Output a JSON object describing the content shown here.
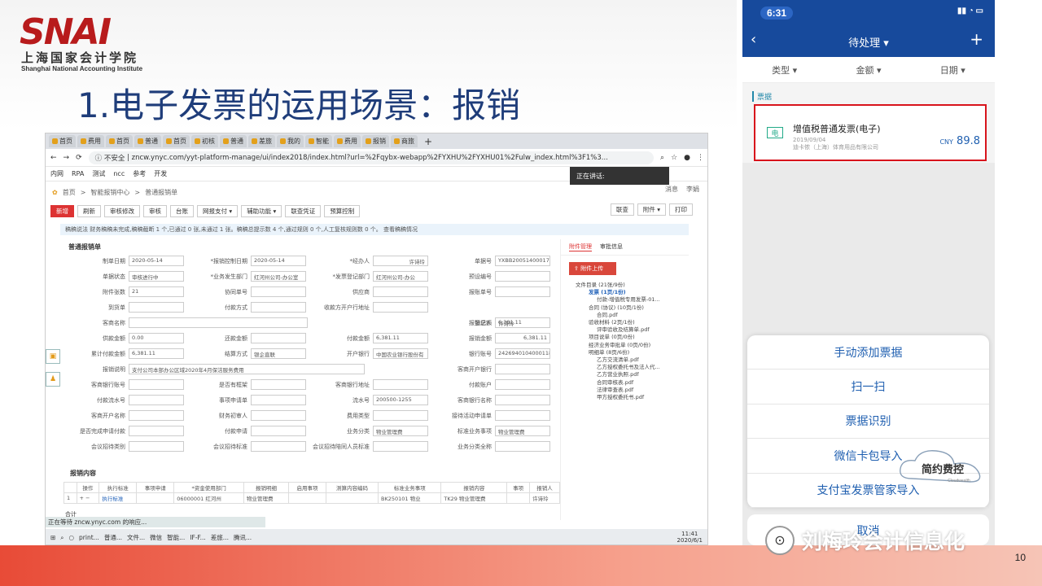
{
  "slide": {
    "logo_word": "SNAI",
    "logo_cn": "上海国家会计学院",
    "logo_en": "Shanghai National Accounting Institute",
    "title": "1.电子发票的运用场景：报销",
    "page_number": "10"
  },
  "browser": {
    "tabs": [
      "首页",
      "费用",
      "首页",
      "普通",
      "首页",
      "初核",
      "普通",
      "差旅",
      "我的",
      "智能",
      "费用",
      "报销",
      "商旅"
    ],
    "url_security": "不安全",
    "url": "zncw.ynyc.com/yyt-platform-manage/ui/index2018/index.html?url=%2Fqybx-webapp%2FYXHU%2FYXHU01%2Fulw_index.html%3F1%3...",
    "bookmarks": [
      "内网",
      "RPA",
      "测试",
      "ncc",
      "参考",
      "开发"
    ],
    "speaking": "正在讲话:",
    "status": "正在等待 zncw.ynyc.com 的响应..."
  },
  "app": {
    "breadcrumb": [
      "首页",
      "智能报销中心",
      "普通报销单"
    ],
    "nav_right": [
      "消息",
      "李娟"
    ],
    "toolbar": [
      "新增",
      "刷新",
      "审核修改",
      "审核",
      "台账",
      "网报支付 ▾",
      "辅助功能 ▾",
      "联查凭证",
      "预算控制"
    ],
    "toolbar_right": [
      "联查",
      "附件 ▾",
      "打印"
    ],
    "notice": "稿稿说法 财务稿稿未完成,稿稿截断 1 个,已通过 0 张,未通过 1 张。稿稿总提示数 4 个,通过规则 0 个,人工复核规则数 0 个。  查看稿稿情况",
    "form_title": "普通报销单",
    "fields": [
      {
        "row": 0,
        "label": "制单日期",
        "value": "2020-05-14"
      },
      {
        "row": 0,
        "label": "*报销控制日期",
        "value": "2020-05-14"
      },
      {
        "row": 0,
        "label": "*经办人",
        "value": "许诗玲"
      },
      {
        "row": 0,
        "label": "单据号",
        "value": "YXBB20051400017"
      },
      {
        "row": 1,
        "label": "单据状态",
        "value": "审核进行中"
      },
      {
        "row": 1,
        "label": "*业务发生部门",
        "value": "红河州公司-办公室"
      },
      {
        "row": 1,
        "label": "*发票登记部门",
        "value": "红河州公司-办公"
      },
      {
        "row": 1,
        "label": "预设编号",
        "value": ""
      },
      {
        "row": 2,
        "label": "附件张数",
        "value": "21"
      },
      {
        "row": 2,
        "label": "协同单号",
        "value": ""
      },
      {
        "row": 2,
        "label": "供应商",
        "value": ""
      },
      {
        "row": 2,
        "label": "报账单号",
        "value": ""
      },
      {
        "row": 3,
        "label": "到货单",
        "value": ""
      },
      {
        "row": 3,
        "label": "付款方式",
        "value": ""
      },
      {
        "row": 3,
        "label": "收款方开户行地址",
        "value": ""
      },
      {
        "row": 4,
        "label": "客商名称",
        "value": ""
      },
      {
        "row": 4,
        "label": "登记人",
        "value": "许诗玲"
      },
      {
        "row": 4,
        "label": "报销总额",
        "value": "6,381.11"
      },
      {
        "row": 5,
        "label": "供款金额",
        "value": "0.00"
      },
      {
        "row": 5,
        "label": "还款金额",
        "value": ""
      },
      {
        "row": 5,
        "label": "付款金额",
        "value": "6,381.11"
      },
      {
        "row": 5,
        "label": "报销金额",
        "value": "6,381.11"
      },
      {
        "row": 6,
        "label": "累计付款金额",
        "value": "6,381.11"
      },
      {
        "row": 6,
        "label": "结算方式",
        "value": "银企直联"
      },
      {
        "row": 6,
        "label": "开户银行",
        "value": "中国农业银行股份有"
      },
      {
        "row": 6,
        "label": "银行账号",
        "value": "2426940104000118"
      },
      {
        "row": 7,
        "label": "报销说明",
        "value": "支付公司本部办公区域2020年4月保洁服务费用"
      },
      {
        "row": 7,
        "label": "客商开户银行",
        "value": ""
      },
      {
        "row": 8,
        "label": "客商银行账号",
        "value": ""
      },
      {
        "row": 8,
        "label": "是否有框架",
        "value": ""
      },
      {
        "row": 8,
        "label": "客商银行地址",
        "value": ""
      },
      {
        "row": 8,
        "label": "付款账户",
        "value": ""
      },
      {
        "row": 9,
        "label": "付款流水号",
        "value": ""
      },
      {
        "row": 9,
        "label": "事项申请单",
        "value": ""
      },
      {
        "row": 9,
        "label": "流水号",
        "value": "200500-1255"
      },
      {
        "row": 9,
        "label": "客商银行名称",
        "value": ""
      },
      {
        "row": 10,
        "label": "客商开户名称",
        "value": ""
      },
      {
        "row": 10,
        "label": "财务初审人",
        "value": ""
      },
      {
        "row": 10,
        "label": "费用类型",
        "value": ""
      },
      {
        "row": 10,
        "label": "接待活动申请单",
        "value": ""
      },
      {
        "row": 11,
        "label": "是否完成申请付款",
        "value": ""
      },
      {
        "row": 11,
        "label": "付款申请",
        "value": ""
      },
      {
        "row": 11,
        "label": "业务分类",
        "value": "物业管理费"
      },
      {
        "row": 11,
        "label": "标准业务事项",
        "value": "物业管理费"
      },
      {
        "row": 12,
        "label": "会议招待类别",
        "value": ""
      },
      {
        "row": 12,
        "label": "会议招待标准",
        "value": ""
      },
      {
        "row": 12,
        "label": "会议招待陪同人员标准",
        "value": ""
      },
      {
        "row": 12,
        "label": "业务分类全称",
        "value": ""
      }
    ],
    "sub_title": "报销内容",
    "sub_headers": [
      "",
      "操作",
      "执行标准",
      "事项申请",
      "*资金使用部门",
      "报销明细",
      "启用事项",
      "测算内容编码",
      "标准业务事项",
      "报销内容",
      "事项",
      "报销人"
    ],
    "sub_row": [
      "1",
      "+ −",
      "执行标准",
      "",
      "06000001 红河州",
      "物业管理费",
      "",
      "",
      "BK250101 物业",
      "TK29 物业管理费",
      "",
      "许诗玲"
    ],
    "sum_label": "合计",
    "attach_tabs": [
      "附件管理",
      "审批信息"
    ],
    "upload_label": "附件上传",
    "tree": [
      {
        "lvl": "l1",
        "text": "文件目录 (21张/9份)"
      },
      {
        "lvl": "l2 sel",
        "text": "发票 (1页/1份)"
      },
      {
        "lvl": "l3",
        "text": "付款-增值税专用发票-01..."
      },
      {
        "lvl": "l2",
        "text": "合同 (协议) (10页/1份)"
      },
      {
        "lvl": "l3",
        "text": "合同.pdf"
      },
      {
        "lvl": "l2",
        "text": "验收材料 (2页/1份)"
      },
      {
        "lvl": "l3",
        "text": "评审验收及结算单.pdf"
      },
      {
        "lvl": "l2",
        "text": "项目说单 (0页/0份)"
      },
      {
        "lvl": "l2",
        "text": "经济业务审批单 (0页/0份)"
      },
      {
        "lvl": "l2",
        "text": "明细单 (8页/6份)"
      },
      {
        "lvl": "l3",
        "text": "乙方交流清单.pdf"
      },
      {
        "lvl": "l3",
        "text": "乙方授权委托书及法人代..."
      },
      {
        "lvl": "l3",
        "text": "乙方营业执照.pdf"
      },
      {
        "lvl": "l3",
        "text": "合同审核表.pdf"
      },
      {
        "lvl": "l3",
        "text": "法律审查表.pdf"
      },
      {
        "lvl": "l3",
        "text": "甲方授权委托书.pdf"
      }
    ],
    "taskbar": [
      "print...",
      "普通...",
      "文件...",
      "微信",
      "智能...",
      "IF-F...",
      "差旅...",
      "腾讯..."
    ],
    "tray_time": "11:41",
    "tray_date": "2020/6/1"
  },
  "phone": {
    "time": "6:31",
    "title": "待处理 ▾",
    "filters": [
      "类型 ▾",
      "金额 ▾",
      "日期 ▾"
    ],
    "section": "票据",
    "card_icon": "电",
    "card_title": "增值税普通发票(电子)",
    "card_date": "2019/09/04",
    "card_vendor": "迪卡侬（上海）体育用品有限公司",
    "card_currency": "CNY",
    "card_amount": "89.8",
    "sheet_options": [
      "手动添加票据",
      "扫一扫",
      "票据识别",
      "微信卡包导入",
      "支付宝发票管家导入"
    ],
    "cancel": "取消"
  },
  "watermark": {
    "badge": "简约费控",
    "badge_sub": "Cloudwealth",
    "text": "刘梅玲会计信息化"
  },
  "colors": {
    "brand_red": "#b81b1c",
    "title_blue": "#1f3d7a",
    "phone_blue": "#174a9c",
    "highlight": "#d8141c"
  }
}
